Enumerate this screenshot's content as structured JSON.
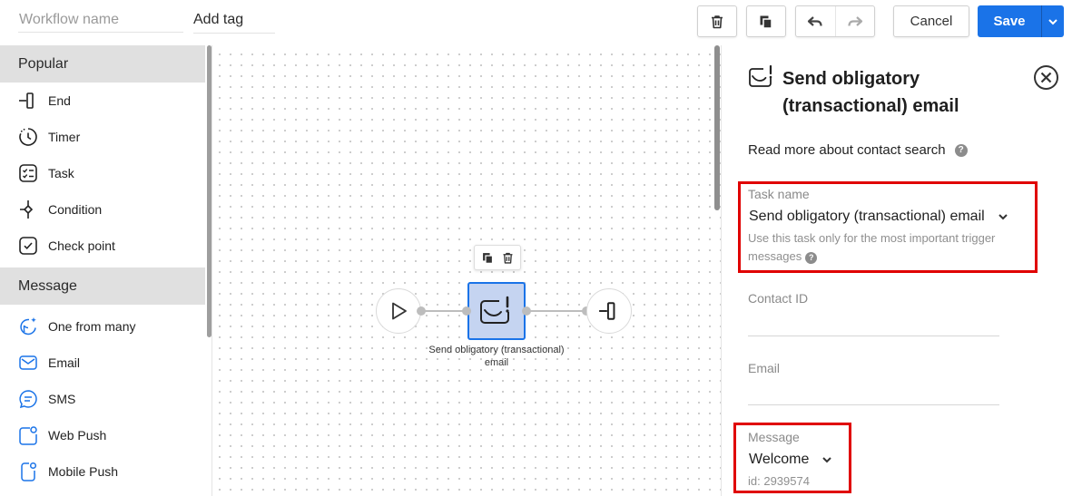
{
  "header": {
    "workflow_name_placeholder": "Workflow name",
    "add_tag_label": "Add tag",
    "cancel_label": "Cancel",
    "save_label": "Save"
  },
  "sidebar": {
    "sections": [
      {
        "title": "Popular",
        "items": [
          {
            "label": "End",
            "icon": "end-icon"
          },
          {
            "label": "Timer",
            "icon": "timer-icon"
          },
          {
            "label": "Task",
            "icon": "task-icon"
          },
          {
            "label": "Condition",
            "icon": "condition-icon"
          },
          {
            "label": "Check point",
            "icon": "check-point-icon"
          }
        ]
      },
      {
        "title": "Message",
        "items": [
          {
            "label": "One from many",
            "icon": "one-from-many-icon"
          },
          {
            "label": "Email",
            "icon": "email-icon"
          },
          {
            "label": "SMS",
            "icon": "sms-icon"
          },
          {
            "label": "Web Push",
            "icon": "web-push-icon"
          },
          {
            "label": "Mobile Push",
            "icon": "mobile-push-icon"
          }
        ]
      }
    ]
  },
  "canvas": {
    "task_node_label": "Send obligatory (transactional) email"
  },
  "panel": {
    "title": "Send obligatory (transactional) email",
    "read_more": "Read more about contact search",
    "task_name_label": "Task name",
    "task_name_value": "Send obligatory (transactional) email",
    "task_hint": "Use this task only for the most important trigger messages",
    "contact_id_label": "Contact ID",
    "email_label": "Email",
    "message_label": "Message",
    "message_value": "Welcome",
    "message_id": "id: 2939574"
  },
  "colors": {
    "accent": "#1a73e8",
    "highlight": "#e00000",
    "section_bg": "#e0e0e0",
    "node_fill": "#c5d4f1"
  }
}
